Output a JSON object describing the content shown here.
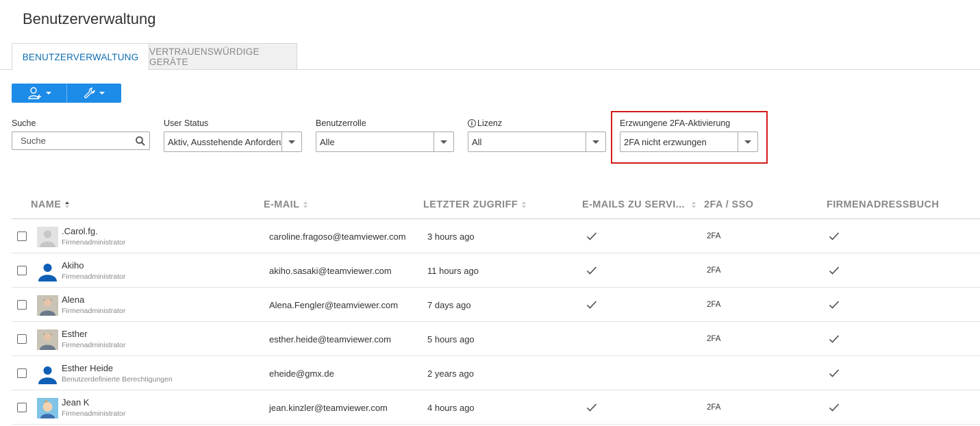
{
  "page": {
    "title": "Benutzerverwaltung"
  },
  "tabs": [
    {
      "label": "BENUTZERVERWALTUNG",
      "active": true
    },
    {
      "label": "VERTRAUENSWÜRDIGE GERÄTE",
      "active": false
    }
  ],
  "toolbar": {
    "add_user_icon": "add-user-icon",
    "settings_icon": "wrench-icon",
    "accent_color": "#1d8be8"
  },
  "filters": {
    "search": {
      "label": "Suche",
      "placeholder": "Suche",
      "value": ""
    },
    "user_status": {
      "label": "User Status",
      "value": "Aktiv, Ausstehende Anforderungen"
    },
    "role": {
      "label": "Benutzerrolle",
      "value": "Alle"
    },
    "license": {
      "label": "Lizenz",
      "value": "All"
    },
    "tfa": {
      "label": "Erzwungene 2FA-Aktivierung",
      "value": "2FA nicht erzwungen"
    },
    "highlight_color": "#d51a1a"
  },
  "table": {
    "columns": {
      "name": "NAME",
      "email": "E-MAIL",
      "last_access": "LETZTER ZUGRIFF",
      "service_mails": "E-MAILS ZU SERVI...",
      "tfa": "2FA / SSO",
      "address_book": "FIRMENADRESSBUCH"
    },
    "rows": [
      {
        "name": ".Carol.fg.",
        "role": "Firmenadministrator",
        "email": "caroline.fragoso@teamviewer.com",
        "last_access": "3 hours ago",
        "service_mails": true,
        "tfa": "2FA",
        "address_book": true,
        "avatar": "placeholder-avatar"
      },
      {
        "name": "Akiho",
        "role": "Firmenadministrator",
        "email": "akiho.sasaki@teamviewer.com",
        "last_access": "11 hours ago",
        "service_mails": true,
        "tfa": "2FA",
        "address_book": true,
        "avatar": "blue-person-avatar"
      },
      {
        "name": "Alena",
        "role": "Firmenadministrator",
        "email": "Alena.Fengler@teamviewer.com",
        "last_access": "7 days ago",
        "service_mails": true,
        "tfa": "2FA",
        "address_book": true,
        "avatar": "photo-avatar"
      },
      {
        "name": "Esther",
        "role": "Firmenadministrator",
        "email": "esther.heide@teamviewer.com",
        "last_access": "5 hours ago",
        "service_mails": false,
        "tfa": "2FA",
        "address_book": true,
        "avatar": "photo-avatar"
      },
      {
        "name": "Esther Heide",
        "role": "Benutzerdefinierte Berechtigungen",
        "email": "eheide@gmx.de",
        "last_access": "2 years ago",
        "service_mails": false,
        "tfa": "",
        "address_book": true,
        "avatar": "blue-person-avatar"
      },
      {
        "name": "Jean K",
        "role": "Firmenadministrator",
        "email": "jean.kinzler@teamviewer.com",
        "last_access": "4 hours ago",
        "service_mails": true,
        "tfa": "2FA",
        "address_book": true,
        "avatar": "cartoon-avatar"
      }
    ]
  }
}
